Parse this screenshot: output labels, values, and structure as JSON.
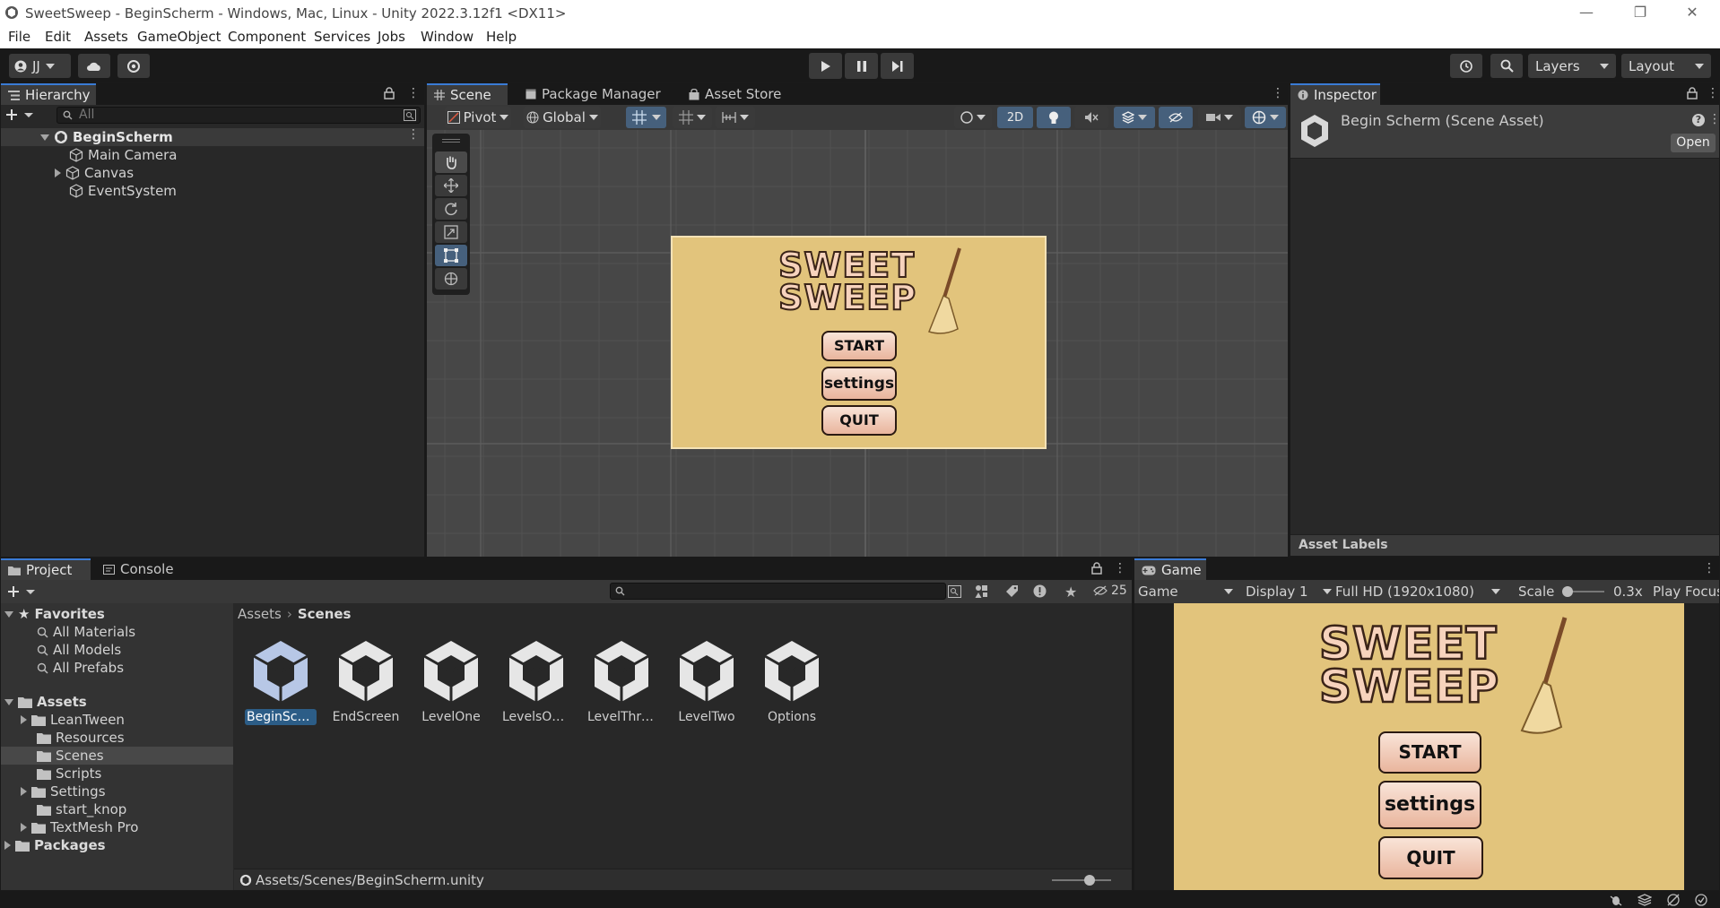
{
  "window": {
    "title": "SweetSweep - BeginScherm - Windows, Mac, Linux - Unity 2022.3.12f1 <DX11>",
    "controls": [
      "—",
      "❐",
      "✕"
    ]
  },
  "menu": [
    "File",
    "Edit",
    "Assets",
    "GameObject",
    "Component",
    "Services",
    "Jobs",
    "Window",
    "Help"
  ],
  "toolbar": {
    "account": "JJ",
    "layers": "Layers",
    "layout": "Layout"
  },
  "hierarchy": {
    "tab": "Hierarchy",
    "search_placeholder": "All",
    "scene": "BeginScherm",
    "items": [
      "Main Camera",
      "Canvas",
      "EventSystem"
    ]
  },
  "scene_tabs": [
    "Scene",
    "Package Manager",
    "Asset Store"
  ],
  "scene_toolbar": {
    "pivot": "Pivot",
    "global": "Global",
    "mode_2d": "2D"
  },
  "game_preview": {
    "title_line1": "SWEET",
    "title_line2": "SWEEP",
    "buttons": [
      "START",
      "settings",
      "QUIT"
    ]
  },
  "inspector": {
    "tab": "Inspector",
    "asset_name": "Begin Scherm (Scene Asset)",
    "open_button": "Open",
    "help": "?",
    "asset_labels": "Asset Labels"
  },
  "project": {
    "tabs": [
      "Project",
      "Console"
    ],
    "favorites_label": "Favorites",
    "favorites": [
      "All Materials",
      "All Models",
      "All Prefabs"
    ],
    "assets_label": "Assets",
    "asset_folders": [
      "LeanTween",
      "Resources",
      "Scenes",
      "Scripts",
      "Settings",
      "start_knop",
      "TextMesh Pro"
    ],
    "packages_label": "Packages",
    "breadcrumb": [
      "Assets",
      "Scenes"
    ],
    "files": [
      "BeginSche...",
      "EndScreen",
      "LevelOne",
      "LevelsOve...",
      "LevelThree",
      "LevelTwo",
      "Options"
    ],
    "hidden_count": "25",
    "status_path": "Assets/Scenes/BeginScherm.unity"
  },
  "game": {
    "tab": "Game",
    "view": "Game",
    "display": "Display 1",
    "resolution": "Full HD (1920x1080)",
    "scale_label": "Scale",
    "scale_value": "0.3x",
    "play_focus": "Play Focus",
    "scale_fraction": 0.1
  },
  "colors": {
    "accent": "#3a7bd5",
    "panel": "#282828",
    "game_bg": "#e2c47c",
    "selection": "#2c5d87"
  }
}
